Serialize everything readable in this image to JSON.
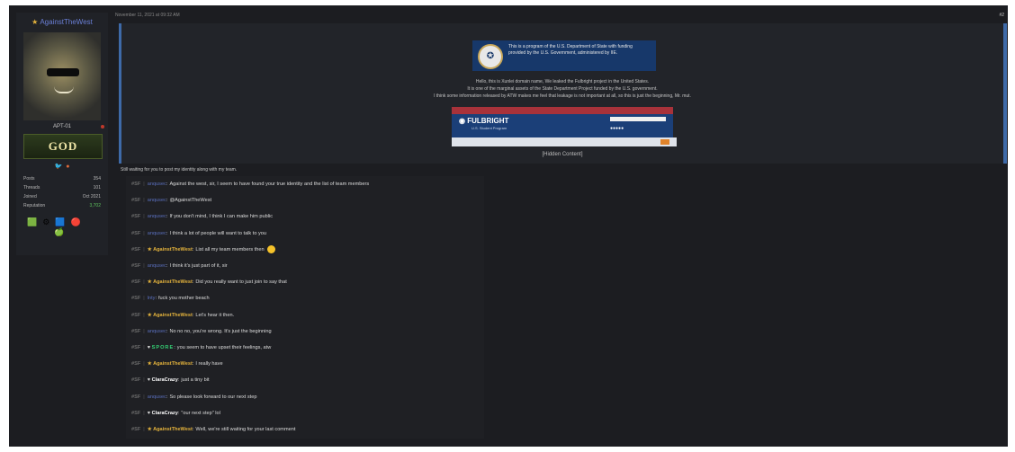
{
  "sidebar": {
    "username": "AgainstTheWest",
    "user_title": "APT-01",
    "rank_banner": "GOD",
    "stats": [
      {
        "label": "Posts",
        "value": "354"
      },
      {
        "label": "Threads",
        "value": "101"
      },
      {
        "label": "Joined",
        "value": "Oct 2021"
      },
      {
        "label": "Reputation",
        "value": "3,702"
      }
    ],
    "icons": [
      "twitter-icon",
      "reddit-icon"
    ],
    "awards": [
      "award-icon",
      "award-icon",
      "award-icon",
      "award-icon",
      "award-icon"
    ]
  },
  "post": {
    "date": "November 11, 2021 at 09:32 AM",
    "number": "#2",
    "state_banner": "This is a program of the U.S. Department of State with funding provided by the U.S. Government, administered by IIE.",
    "lines": [
      "Hello, this is Xunlei domain name, We leaked the Fulbright project in the United States.",
      "It is one of the marginal assets of the State Department Project funded by the U.S. government.",
      "I think some information released by ATW makes me feel that leakage is not important at all, so this is just the beginning, Mr. mut."
    ],
    "fulbright": {
      "title": "FULBRIGHT",
      "subtitle": "U.S. Student Program"
    },
    "hidden_content": "[Hidden Content]",
    "waiting_text": "Still waiting for you to post my identity along with my team."
  },
  "chat": [
    {
      "user": "anqusec",
      "style": "plain",
      "text": "Against the west, sir, I seem to have found your true identity and the list of team members"
    },
    {
      "user": "anqusec",
      "style": "plain",
      "text": "@AgainstTheWest"
    },
    {
      "user": "anqusec",
      "style": "plain",
      "text": "If you don't mind, I think I can make him public"
    },
    {
      "user": "anqusec",
      "style": "plain",
      "text": "I think a lot of people will want to talk to you"
    },
    {
      "user": "AgainstTheWest",
      "style": "atw",
      "text": "List all my team members then",
      "emoji": true
    },
    {
      "user": "anqusec",
      "style": "plain",
      "text": "I think it's just part of it, sir"
    },
    {
      "user": "AgainstTheWest",
      "style": "atw",
      "text": "Did you really want to just join to say that"
    },
    {
      "user": "lnty",
      "style": "plain",
      "text": "fuck you mother beach"
    },
    {
      "user": "AgainstTheWest",
      "style": "atw",
      "text": "Let's hear it then."
    },
    {
      "user": "anqusec",
      "style": "plain",
      "text": "No no no, you're wrong. It's just the beginning"
    },
    {
      "user": "SPORE",
      "style": "spore",
      "text": "you seem to have upset their feelings, atw"
    },
    {
      "user": "AgainstTheWest",
      "style": "atw",
      "text": "I really have"
    },
    {
      "user": "ClaraCrazy",
      "style": "white",
      "text": "just a tiny bit"
    },
    {
      "user": "anqusec",
      "style": "plain",
      "text": "So please look forward to our next step"
    },
    {
      "user": "ClaraCrazy",
      "style": "white",
      "text": "\"our next step\" lol"
    },
    {
      "user": "AgainstTheWest",
      "style": "atw",
      "text": "Well, we're still waiting for your last comment"
    }
  ],
  "chat_tag": "#SF",
  "colors": {
    "accent_blue": "#3e6aa8",
    "atw_gold": "#e3b23c",
    "spore_green": "#34d074"
  }
}
